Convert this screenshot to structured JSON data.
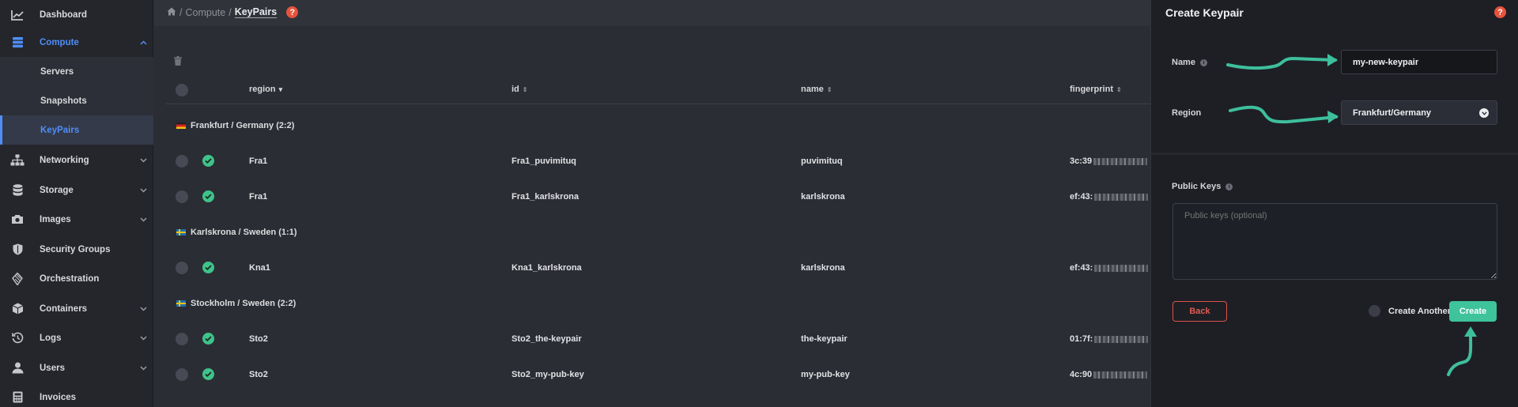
{
  "sidebar": {
    "items": [
      {
        "label": "Dashboard",
        "icon": "chart-icon"
      },
      {
        "label": "Compute",
        "icon": "server-stack-icon",
        "expanded": true
      },
      {
        "label": "Servers"
      },
      {
        "label": "Snapshots"
      },
      {
        "label": "KeyPairs",
        "selected": true
      },
      {
        "label": "Networking",
        "icon": "network-icon"
      },
      {
        "label": "Storage",
        "icon": "database-icon"
      },
      {
        "label": "Images",
        "icon": "camera-icon"
      },
      {
        "label": "Security Groups",
        "icon": "shield-icon"
      },
      {
        "label": "Orchestration",
        "icon": "orchestration-icon"
      },
      {
        "label": "Containers",
        "icon": "cube-icon"
      },
      {
        "label": "Logs",
        "icon": "history-icon"
      },
      {
        "label": "Users",
        "icon": "user-icon"
      },
      {
        "label": "Invoices",
        "icon": "calculator-icon"
      }
    ]
  },
  "breadcrumb": {
    "sep1": "/",
    "compute": "Compute",
    "sep2": "/",
    "current": "KeyPairs",
    "help": "?"
  },
  "table": {
    "columns": {
      "region": "region",
      "id": "id",
      "name": "name",
      "fingerprint": "fingerprint"
    },
    "groups": [
      {
        "label": "Frankfurt / Germany (2:2)",
        "flag": "de",
        "rows": [
          {
            "region": "Fra1",
            "id": "Fra1_puvimituq",
            "name": "puvimituq",
            "fingerprint": "3c:39"
          },
          {
            "region": "Fra1",
            "id": "Fra1_karlskrona",
            "name": "karlskrona",
            "fingerprint": "ef:43:"
          }
        ]
      },
      {
        "label": "Karlskrona / Sweden (1:1)",
        "flag": "se",
        "rows": [
          {
            "region": "Kna1",
            "id": "Kna1_karlskrona",
            "name": "karlskrona",
            "fingerprint": "ef:43:"
          }
        ]
      },
      {
        "label": "Stockholm / Sweden (2:2)",
        "flag": "se",
        "rows": [
          {
            "region": "Sto2",
            "id": "Sto2_the-keypair",
            "name": "the-keypair",
            "fingerprint": "01:7f:"
          },
          {
            "region": "Sto2",
            "id": "Sto2_my-pub-key",
            "name": "my-pub-key",
            "fingerprint": "4c:90"
          }
        ]
      }
    ]
  },
  "panel": {
    "title": "Create Keypair",
    "help": "?",
    "name_label": "Name",
    "name_value": "my-new-keypair",
    "region_label": "Region",
    "region_value": "Frankfurt/Germany",
    "public_keys_label": "Public Keys",
    "public_keys_placeholder": "Public keys (optional)",
    "back_label": "Back",
    "create_another_label": "Create Another",
    "create_label": "Create"
  },
  "colors": {
    "accent": "#4f8ef7",
    "success": "#3ec38a",
    "danger": "#e05a50",
    "annotation_arrow": "#3ebf9c"
  }
}
